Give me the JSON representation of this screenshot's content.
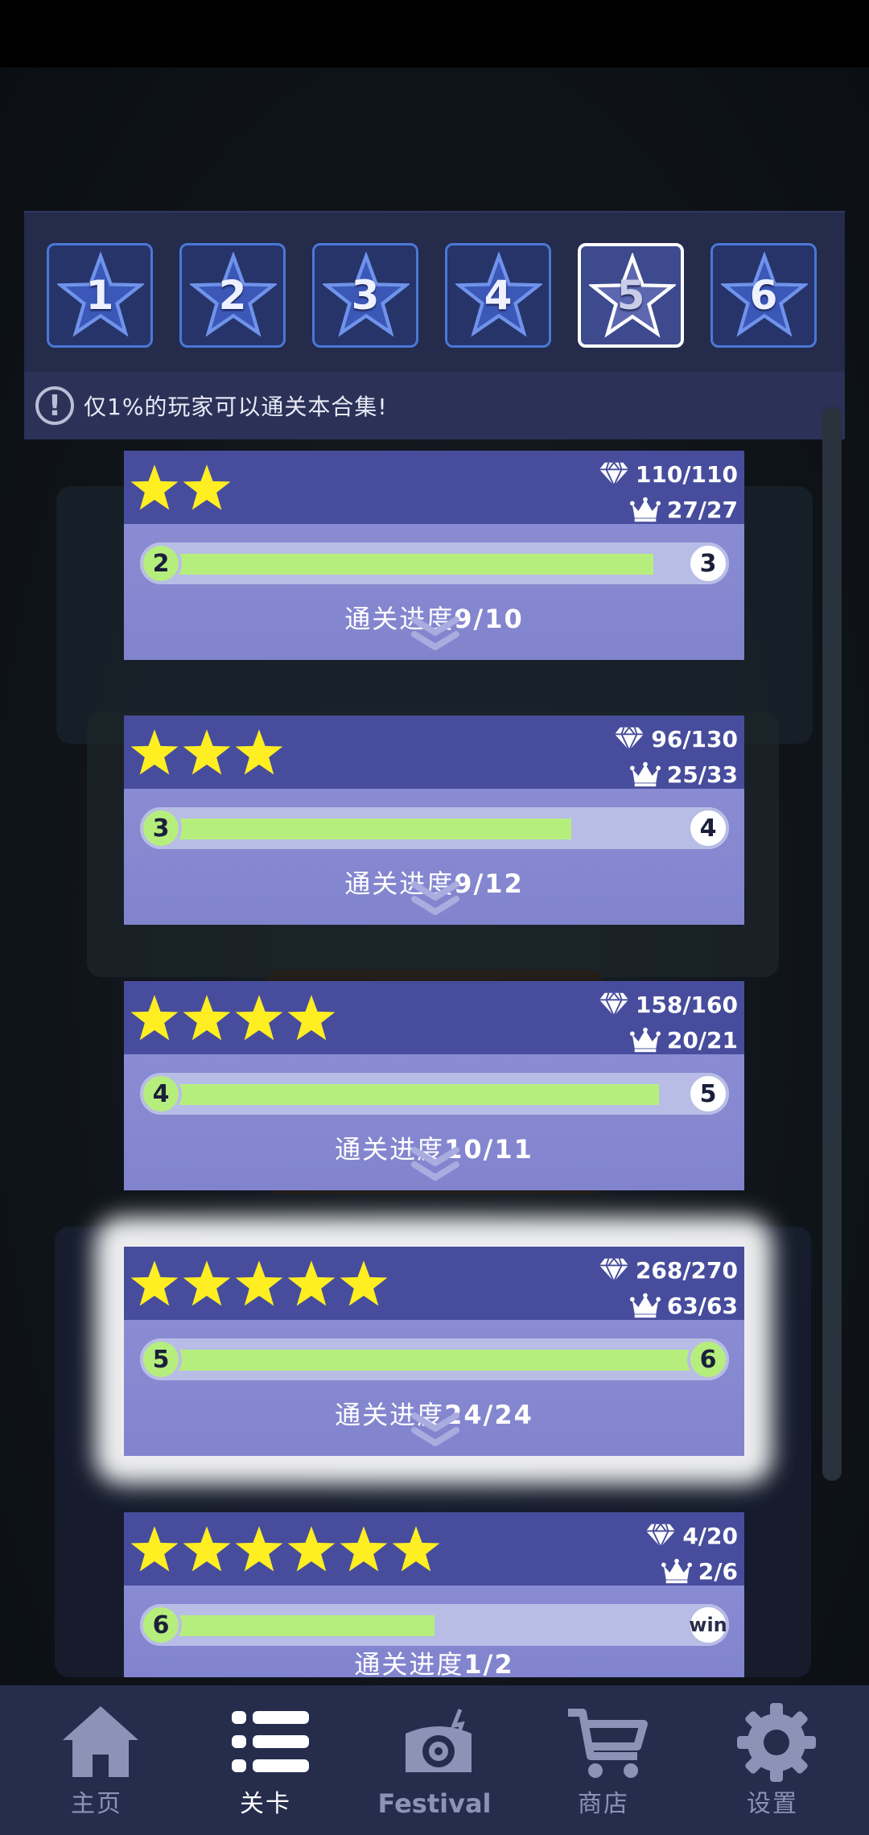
{
  "set_tabs": [
    {
      "number": "1",
      "active": false
    },
    {
      "number": "2",
      "active": false
    },
    {
      "number": "3",
      "active": false
    },
    {
      "number": "4",
      "active": false
    },
    {
      "number": "5",
      "active": true
    },
    {
      "number": "6",
      "active": false
    }
  ],
  "notice": {
    "icon": "exclamation-icon",
    "text": "仅1%的玩家可以通关本合集!"
  },
  "levels": [
    {
      "stars": 2,
      "gems": "110/110",
      "crowns": "27/27",
      "from": "2",
      "to": "3",
      "progress_label": "通关进度",
      "progress_value": "9/10",
      "fill_fraction": 0.9
    },
    {
      "stars": 3,
      "gems": "96/130",
      "crowns": "25/33",
      "from": "3",
      "to": "4",
      "progress_label": "通关进度",
      "progress_value": "9/12",
      "fill_fraction": 0.75
    },
    {
      "stars": 4,
      "gems": "158/160",
      "crowns": "20/21",
      "from": "4",
      "to": "5",
      "progress_label": "通关进度",
      "progress_value": "10/11",
      "fill_fraction": 0.91
    },
    {
      "stars": 5,
      "gems": "268/270",
      "crowns": "63/63",
      "from": "5",
      "to": "6",
      "progress_label": "通关进度",
      "progress_value": "24/24",
      "fill_fraction": 1.0
    },
    {
      "stars": 6,
      "gems": "4/20",
      "crowns": "2/6",
      "from": "6",
      "to": "win",
      "progress_label": "通关进度",
      "progress_value": "1/2",
      "fill_fraction": 0.5
    }
  ],
  "nav": [
    {
      "label": "主页",
      "icon": "home-icon",
      "active": false
    },
    {
      "label": "关卡",
      "icon": "list-icon",
      "active": true
    },
    {
      "label": "Festival",
      "icon": "music-box-icon",
      "active": false
    },
    {
      "label": "商店",
      "icon": "cart-icon",
      "active": false
    },
    {
      "label": "设置",
      "icon": "gear-icon",
      "active": false
    }
  ],
  "colors": {
    "card_header": "#474d9c",
    "card_body": "#8e90d6",
    "progress_fill": "#b6ee7e",
    "star": "#ffee22",
    "tab_border": "#4a78d6",
    "nav_bg": "#262c4c"
  }
}
